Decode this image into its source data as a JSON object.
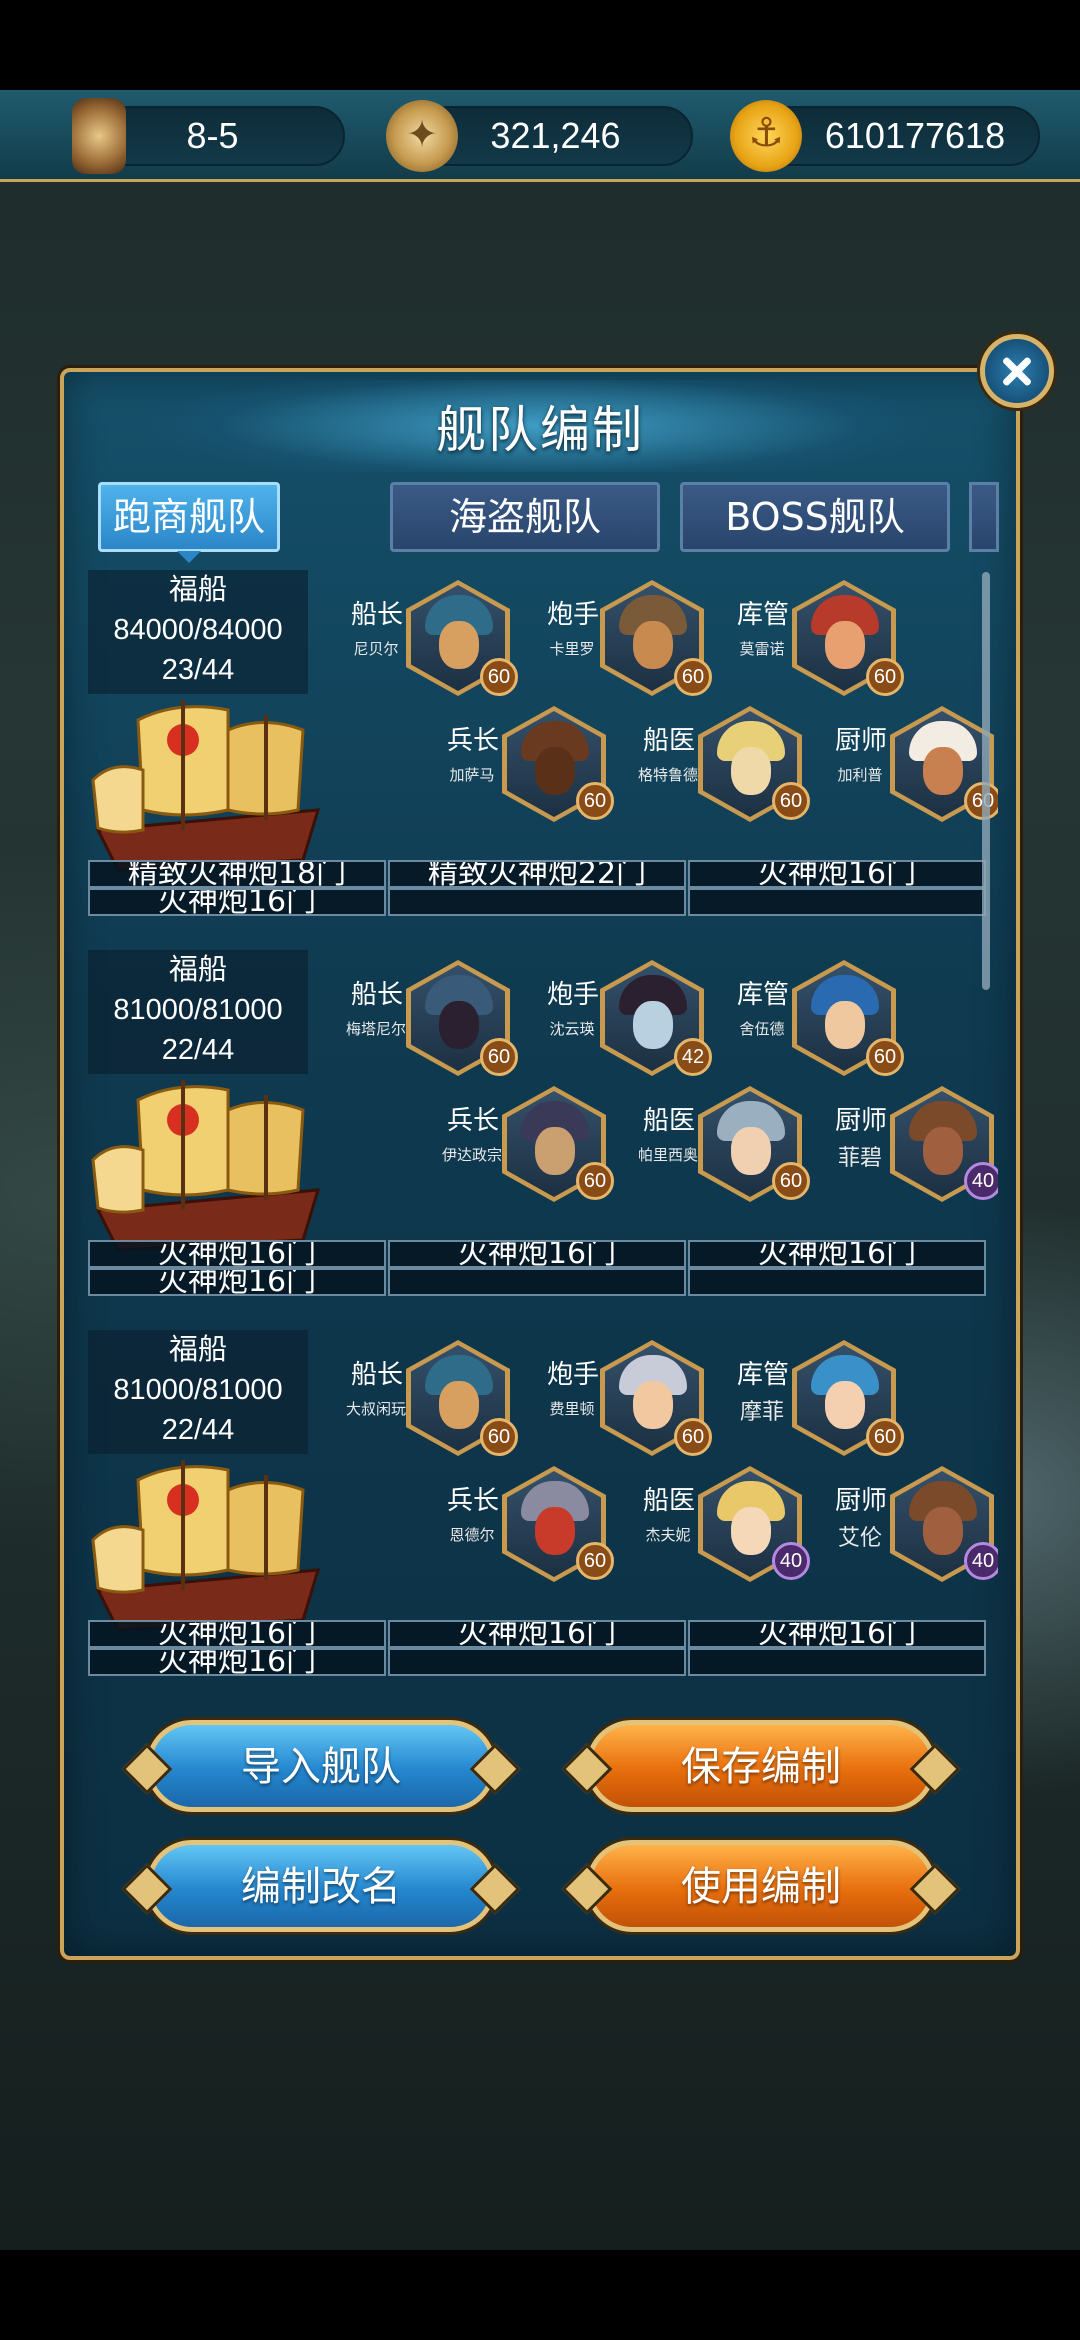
{
  "resources": [
    {
      "icon": "hourglass-icon",
      "value": "8-5"
    },
    {
      "icon": "compass-icon",
      "value": "321,246"
    },
    {
      "icon": "anchor-coin-icon",
      "value": "610177618"
    }
  ],
  "panel": {
    "title": "舰队编制",
    "tabs": [
      "跑商舰队",
      "海盗舰队",
      "BOSS舰队"
    ],
    "active_tab": "跑商舰队"
  },
  "fleets": [
    {
      "ship_type": "福船",
      "durability": "84000/84000",
      "crew_count": "23/44",
      "crew": [
        {
          "role": "船长",
          "name": "尼贝尔",
          "level": "60"
        },
        {
          "role": "炮手",
          "name": "卡里罗",
          "level": "60"
        },
        {
          "role": "库管",
          "name": "莫雷诺",
          "level": "60"
        },
        {
          "role": "兵长",
          "name": "加萨马",
          "level": "60"
        },
        {
          "role": "船医",
          "name": "格特鲁德",
          "level": "60"
        },
        {
          "role": "厨师",
          "name": "加利普",
          "level": "60"
        }
      ],
      "cannons": [
        "精致火神炮18门",
        "精致火神炮22门",
        "火神炮16门",
        "火神炮16门",
        "",
        ""
      ]
    },
    {
      "ship_type": "福船",
      "durability": "81000/81000",
      "crew_count": "22/44",
      "crew": [
        {
          "role": "船长",
          "name": "梅塔尼尔",
          "level": "60"
        },
        {
          "role": "炮手",
          "name": "沈云瑛",
          "level": "42"
        },
        {
          "role": "库管",
          "name": "舍伍德",
          "level": "60"
        },
        {
          "role": "兵长",
          "name": "伊达政宗",
          "level": "60"
        },
        {
          "role": "船医",
          "name": "帕里西奥",
          "level": "60"
        },
        {
          "role": "厨师",
          "name": "菲碧",
          "level": "40"
        }
      ],
      "cannons": [
        "火神炮16门",
        "火神炮16门",
        "火神炮16门",
        "火神炮16门",
        "",
        ""
      ]
    },
    {
      "ship_type": "福船",
      "durability": "81000/81000",
      "crew_count": "22/44",
      "crew": [
        {
          "role": "船长",
          "name": "大叔闲玩",
          "level": "60"
        },
        {
          "role": "炮手",
          "name": "费里顿",
          "level": "60"
        },
        {
          "role": "库管",
          "name": "摩菲",
          "level": "60"
        },
        {
          "role": "兵长",
          "name": "恩德尔",
          "level": "60"
        },
        {
          "role": "船医",
          "name": "杰夫妮",
          "level": "40"
        },
        {
          "role": "厨师",
          "name": "艾伦",
          "level": "40"
        }
      ],
      "cannons": [
        "火神炮16门",
        "火神炮16门",
        "火神炮16门",
        "火神炮16门",
        "",
        ""
      ]
    }
  ],
  "buttons": {
    "import": "导入舰队",
    "save": "保存编制",
    "rename": "编制改名",
    "use": "使用编制"
  },
  "colors": {
    "panel_border": "#c9a45a",
    "tab_active": "#2b86c8",
    "button_blue": "#2486cf",
    "button_orange": "#e86e0c"
  }
}
